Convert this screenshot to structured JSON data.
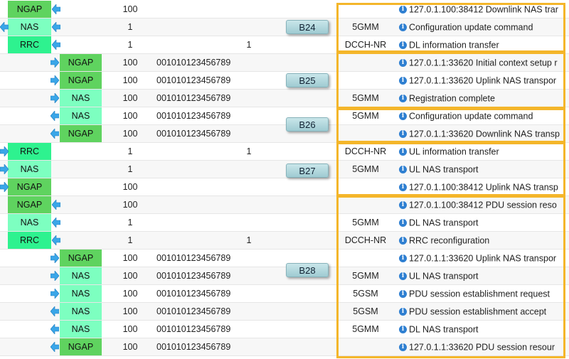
{
  "colors": {
    "ngap": "#5fd35f",
    "nas": "#7dffc0",
    "rrc": "#2ef28f",
    "arrow": "#3aa6e8",
    "highlight_box": "#f4b62a",
    "badge": "#b4d8de"
  },
  "badges": [
    "B24",
    "B25",
    "B26",
    "B27",
    "B28"
  ],
  "rows": [
    {
      "proto": "NGAP",
      "pos": "left",
      "arrow": "to-left",
      "num1": "100",
      "imsi": "",
      "num2": "",
      "layer": "",
      "msg": "127.0.1.100:38412 Downlink NAS trar"
    },
    {
      "proto": "NAS",
      "pos": "left",
      "arrow": "both-left",
      "num1": "1",
      "imsi": "",
      "num2": "",
      "layer": "5GMM",
      "msg": "Configuration update command"
    },
    {
      "proto": "RRC",
      "pos": "left",
      "arrow": "to-left",
      "num1": "1",
      "imsi": "",
      "num2": "1",
      "layer": "DCCH-NR",
      "msg": "DL information transfer"
    },
    {
      "proto": "NGAP",
      "pos": "right",
      "arrow": "to-right",
      "num1": "100",
      "imsi": "001010123456789",
      "num2": "",
      "layer": "",
      "msg": "127.0.1.1:33620 Initial context setup r"
    },
    {
      "proto": "NGAP",
      "pos": "right",
      "arrow": "to-right",
      "num1": "100",
      "imsi": "001010123456789",
      "num2": "",
      "layer": "",
      "msg": "127.0.1.1:33620 Uplink NAS transpor"
    },
    {
      "proto": "NAS",
      "pos": "right",
      "arrow": "to-right",
      "num1": "100",
      "imsi": "001010123456789",
      "num2": "",
      "layer": "5GMM",
      "msg": "Registration complete"
    },
    {
      "proto": "NAS",
      "pos": "right",
      "arrow": "to-left",
      "num1": "100",
      "imsi": "001010123456789",
      "num2": "",
      "layer": "5GMM",
      "msg": "Configuration update command"
    },
    {
      "proto": "NGAP",
      "pos": "right",
      "arrow": "to-left",
      "num1": "100",
      "imsi": "001010123456789",
      "num2": "",
      "layer": "",
      "msg": "127.0.1.1:33620 Downlink NAS transp"
    },
    {
      "proto": "RRC",
      "pos": "left",
      "arrow": "to-right",
      "num1": "1",
      "imsi": "",
      "num2": "1",
      "layer": "DCCH-NR",
      "msg": "UL information transfer"
    },
    {
      "proto": "NAS",
      "pos": "left",
      "arrow": "to-right",
      "num1": "1",
      "imsi": "",
      "num2": "",
      "layer": "5GMM",
      "msg": "UL NAS transport"
    },
    {
      "proto": "NGAP",
      "pos": "left",
      "arrow": "to-right",
      "num1": "100",
      "imsi": "",
      "num2": "",
      "layer": "",
      "msg": "127.0.1.100:38412 Uplink NAS transp"
    },
    {
      "proto": "NGAP",
      "pos": "left",
      "arrow": "to-left",
      "num1": "100",
      "imsi": "",
      "num2": "",
      "layer": "",
      "msg": "127.0.1.100:38412 PDU session reso"
    },
    {
      "proto": "NAS",
      "pos": "left",
      "arrow": "to-left",
      "num1": "1",
      "imsi": "",
      "num2": "",
      "layer": "5GMM",
      "msg": "DL NAS transport"
    },
    {
      "proto": "RRC",
      "pos": "left",
      "arrow": "to-left",
      "num1": "1",
      "imsi": "",
      "num2": "1",
      "layer": "DCCH-NR",
      "msg": "RRC reconfiguration"
    },
    {
      "proto": "NGAP",
      "pos": "right",
      "arrow": "to-right",
      "num1": "100",
      "imsi": "001010123456789",
      "num2": "",
      "layer": "",
      "msg": "127.0.1.1:33620 Uplink NAS transpor"
    },
    {
      "proto": "NAS",
      "pos": "right",
      "arrow": "to-right",
      "num1": "100",
      "imsi": "001010123456789",
      "num2": "",
      "layer": "5GMM",
      "msg": "UL NAS transport"
    },
    {
      "proto": "NAS",
      "pos": "right",
      "arrow": "to-right",
      "num1": "100",
      "imsi": "001010123456789",
      "num2": "",
      "layer": "5GSM",
      "msg": "PDU session establishment request"
    },
    {
      "proto": "NAS",
      "pos": "right",
      "arrow": "to-left",
      "num1": "100",
      "imsi": "001010123456789",
      "num2": "",
      "layer": "5GSM",
      "msg": "PDU session establishment accept"
    },
    {
      "proto": "NAS",
      "pos": "right",
      "arrow": "to-left",
      "num1": "100",
      "imsi": "001010123456789",
      "num2": "",
      "layer": "5GMM",
      "msg": "DL NAS transport"
    },
    {
      "proto": "NGAP",
      "pos": "right",
      "arrow": "to-left",
      "num1": "100",
      "imsi": "001010123456789",
      "num2": "",
      "layer": "",
      "msg": "127.0.1.1:33620 PDU session resour"
    }
  ]
}
